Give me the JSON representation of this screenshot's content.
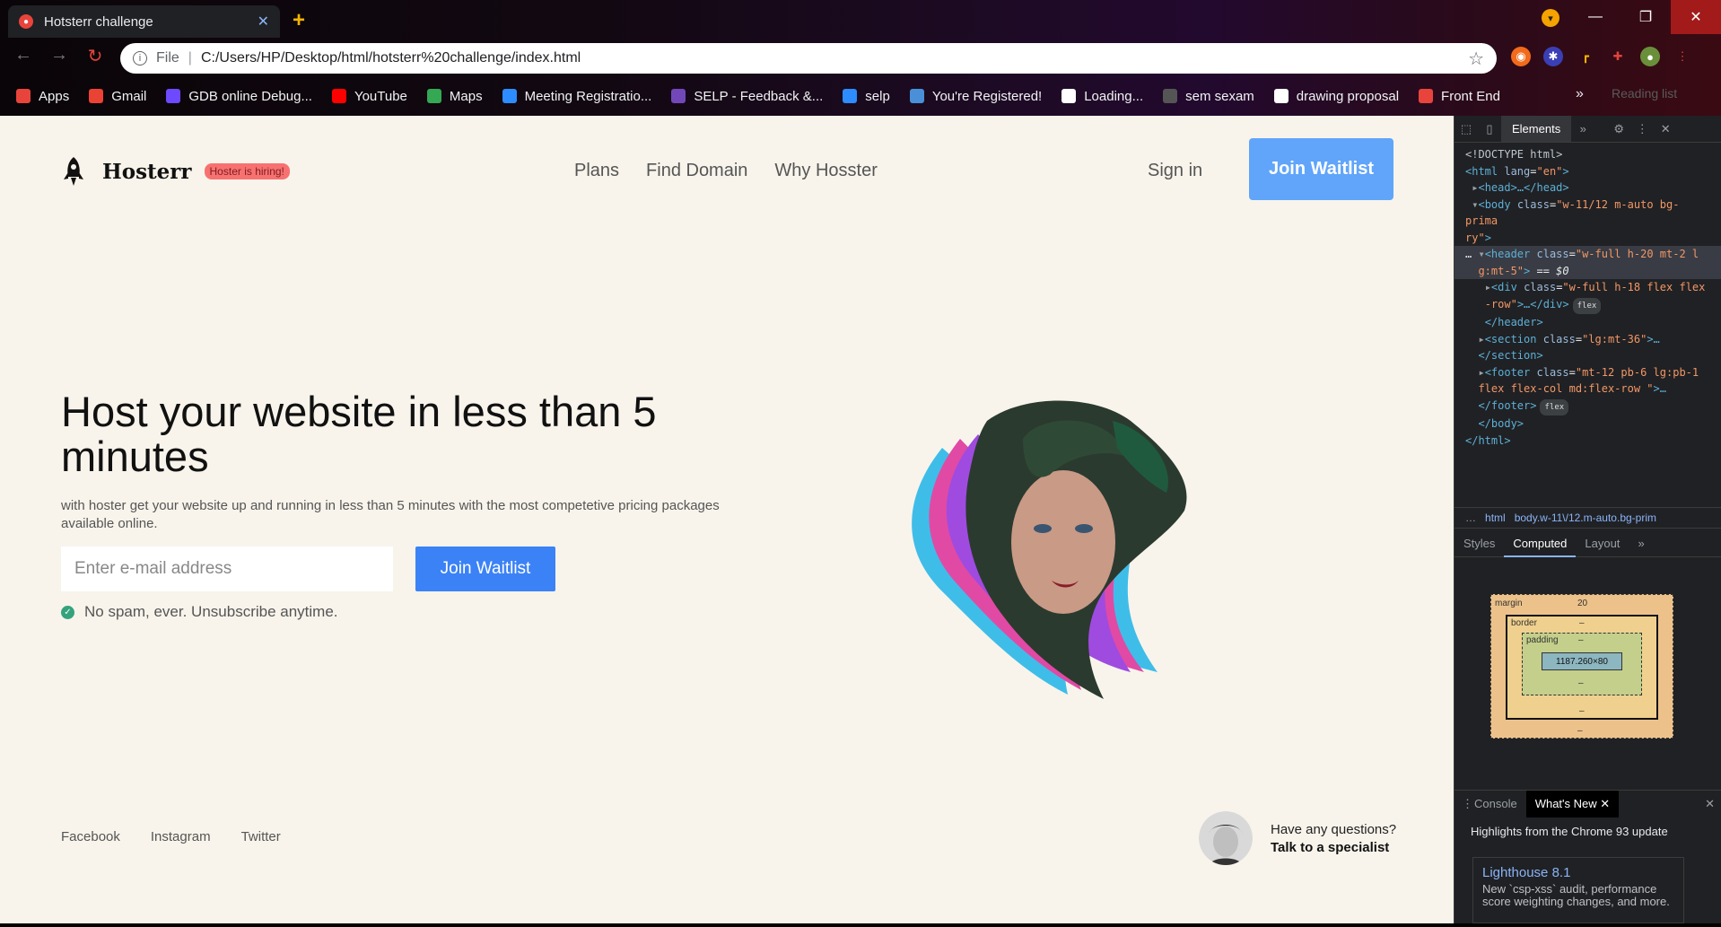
{
  "browser": {
    "tab_title": "Hotsterr challenge",
    "url_scheme": "File",
    "url": "C:/Users/HP/Desktop/html/hotsterr%20challenge/index.html",
    "bookmarks": [
      {
        "label": "Apps",
        "icon": "apps-grid-icon",
        "color": "#e8443c"
      },
      {
        "label": "Gmail",
        "icon": "gmail-icon",
        "color": "#ea4335"
      },
      {
        "label": "GDB online Debug...",
        "icon": "gdb-icon",
        "color": "#6d4aff"
      },
      {
        "label": "YouTube",
        "icon": "youtube-icon",
        "color": "#ff0000"
      },
      {
        "label": "Maps",
        "icon": "maps-icon",
        "color": "#34a853"
      },
      {
        "label": "Meeting Registratio...",
        "icon": "zoom-icon",
        "color": "#2d8cff"
      },
      {
        "label": "SELP - Feedback &...",
        "icon": "forms-icon",
        "color": "#7248b9"
      },
      {
        "label": "selp",
        "icon": "zoom-icon",
        "color": "#2d8cff"
      },
      {
        "label": "You're Registered!",
        "icon": "settings-flower-icon",
        "color": "#4a90d9"
      },
      {
        "label": "Loading...",
        "icon": "page-icon",
        "color": "#ffffff"
      },
      {
        "label": "sem sexam",
        "icon": "avatar-icon",
        "color": "#555555"
      },
      {
        "label": "drawing proposal",
        "icon": "doc-icon",
        "color": "#ffffff"
      },
      {
        "label": "Front End",
        "icon": "chrome-icon",
        "color": "#e8443c"
      }
    ],
    "more_bookmarks": "»",
    "reading_list": "Reading list"
  },
  "page": {
    "brand": "Hosterr",
    "hiring_badge": "Hoster is hiring!",
    "nav": [
      "Plans",
      "Find Domain",
      "Why Hosster"
    ],
    "sign_in": "Sign in",
    "join_top": "Join Waitlist",
    "hero_title": "Host your website in less than 5 minutes",
    "hero_sub": "with hoster get your website up and running in less than 5 minutes with the most competetive pricing packages available online.",
    "email_placeholder": "Enter e-mail address",
    "join_button": "Join Waitlist",
    "no_spam": "No spam, ever. Unsubscribe anytime.",
    "footer_links": [
      "Facebook",
      "Instagram",
      "Twitter"
    ],
    "question": "Have any questions?",
    "talk": "Talk to a specialist"
  },
  "devtools": {
    "active_tab": "Elements",
    "breadcrumb_html": "html",
    "breadcrumb_body": "body.w-11\\/12.m-auto.bg-prim",
    "sub_tabs": [
      "Styles",
      "Computed",
      "Layout"
    ],
    "margin_label": "margin",
    "margin_value": "20",
    "border_label": "border",
    "padding_label": "padding",
    "content_size": "1187.260×80",
    "dash": "–",
    "console_tab": "Console",
    "whats_new_tab": "What's New",
    "highlights": "Highlights from the Chrome 93 update",
    "lighthouse_title": "Lighthouse 8.1",
    "lighthouse_body": "New `csp-xss` audit, performance score weighting changes, and more."
  },
  "colors": {
    "page_bg": "#f8f4eb",
    "primary_button": "#3b82f6",
    "top_button": "#60a5fa",
    "badge_bg": "#f87171"
  }
}
